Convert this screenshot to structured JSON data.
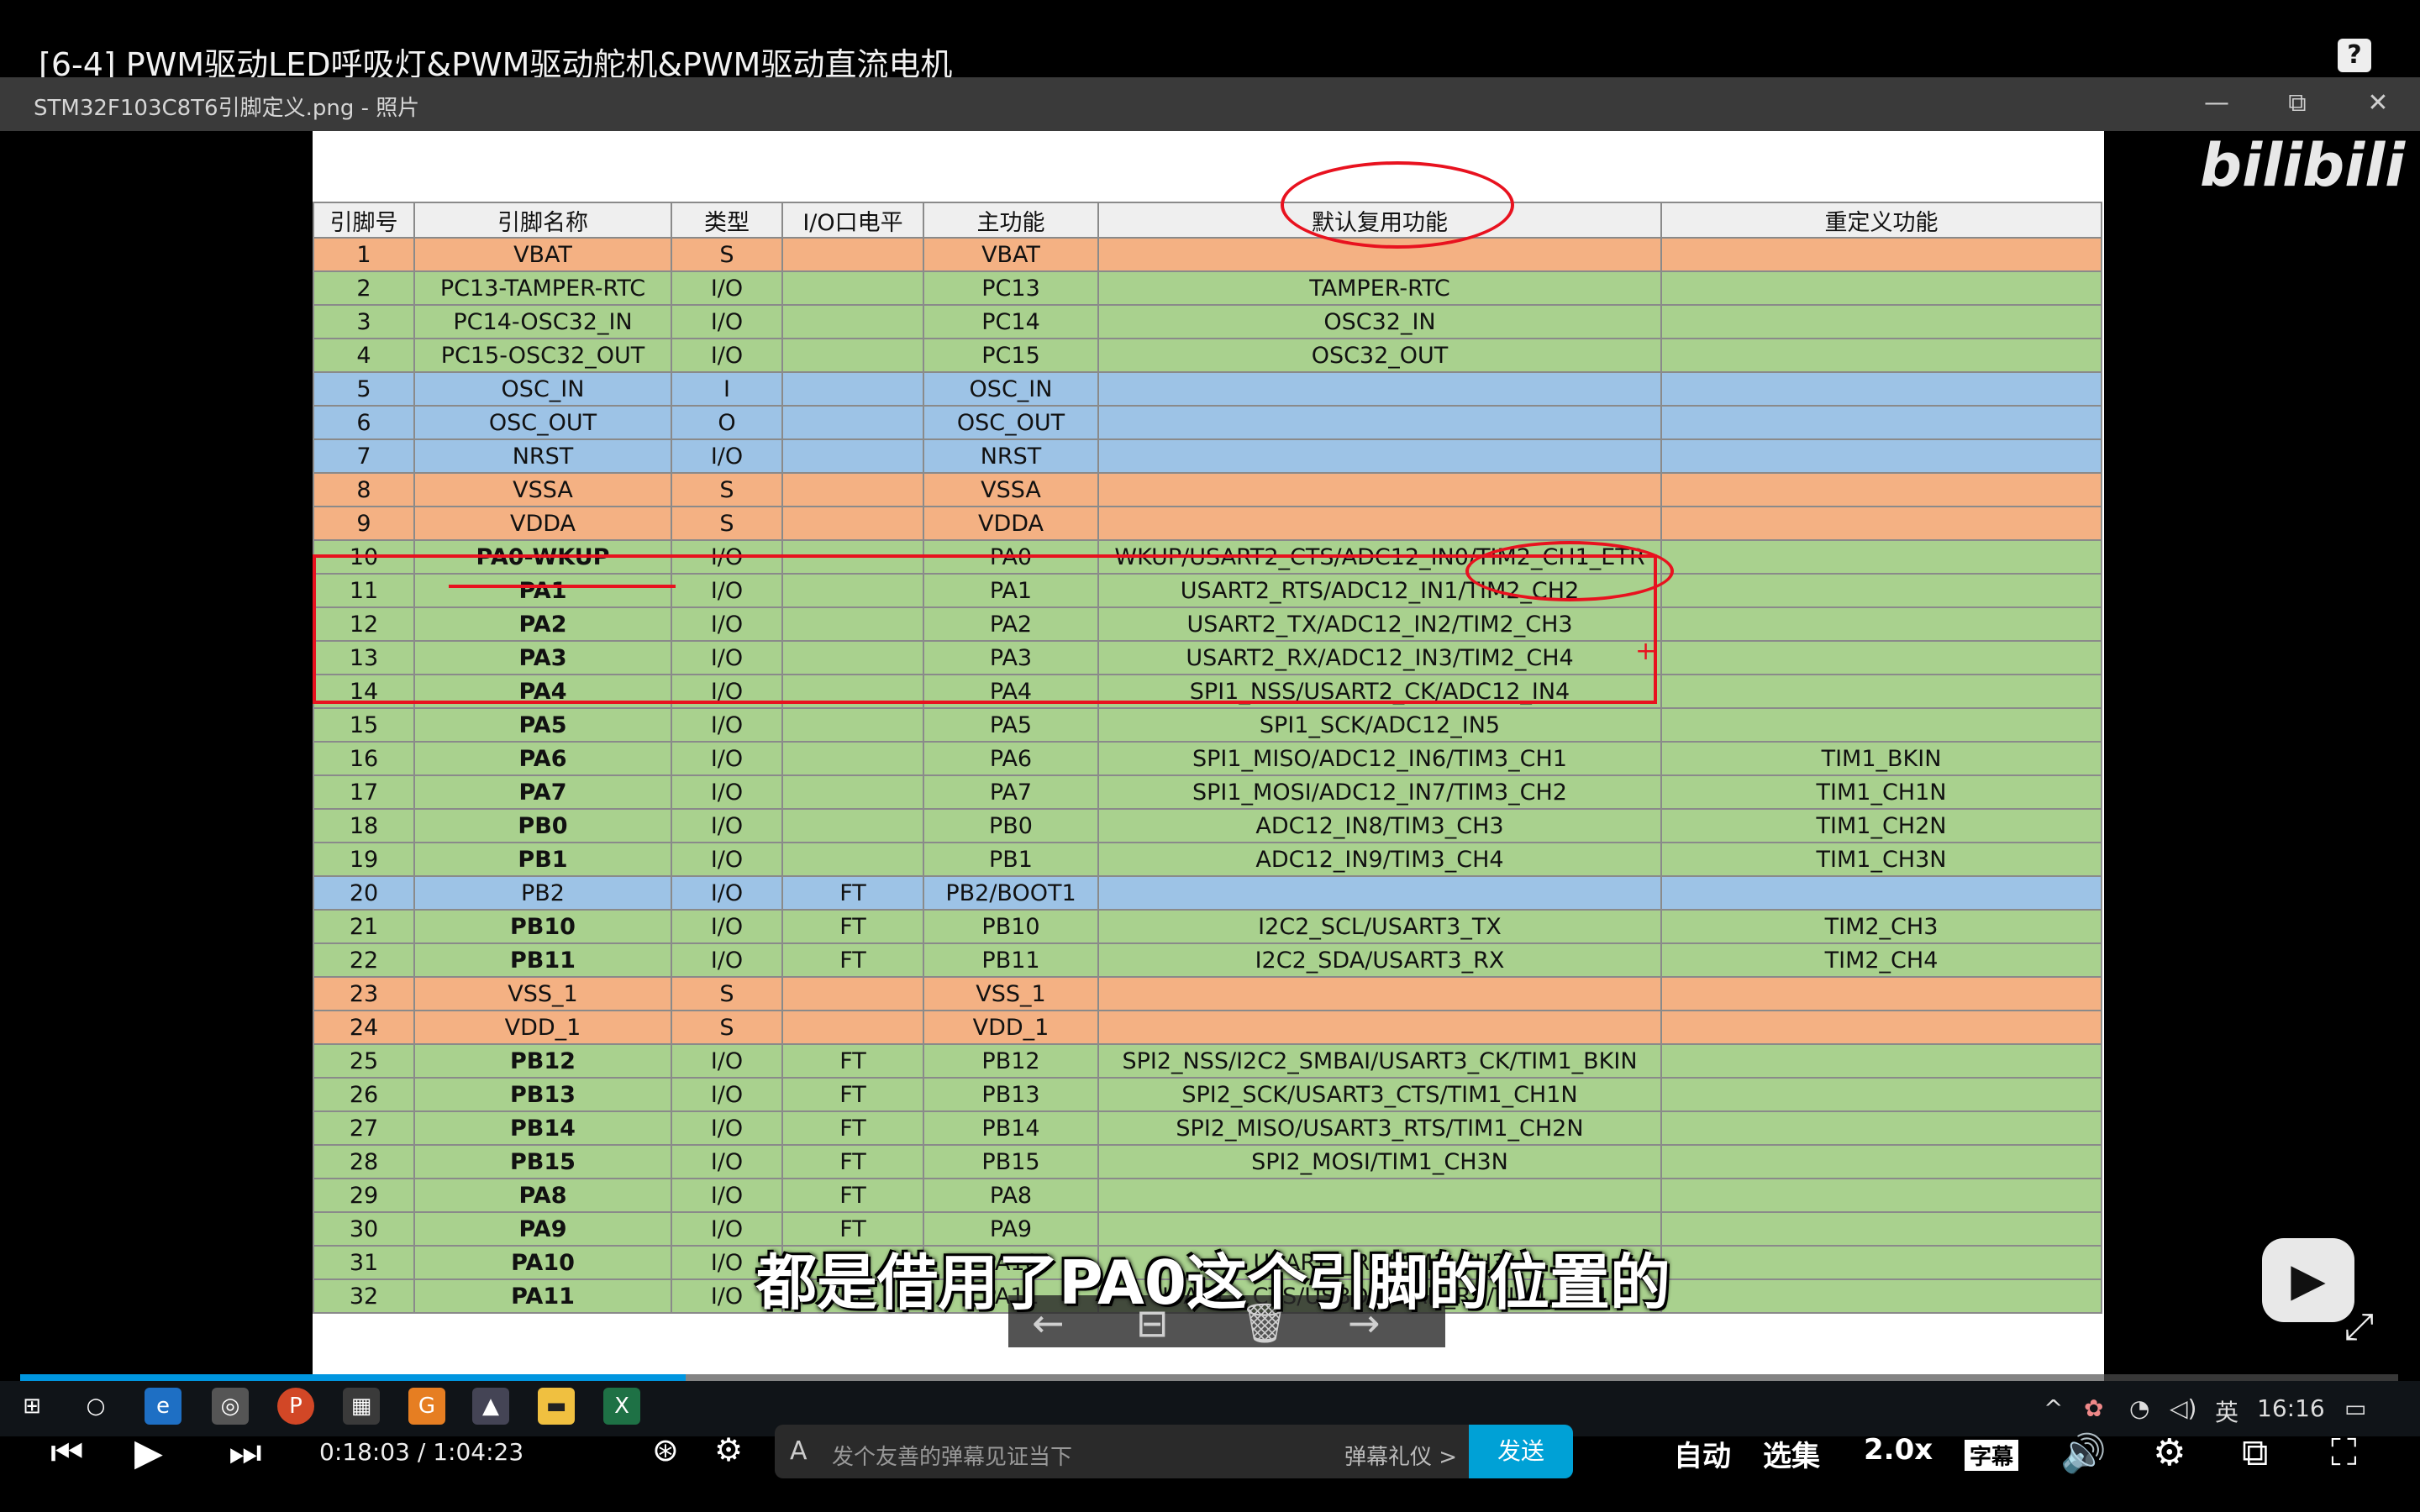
{
  "video": {
    "title": "[6-4] PWM驱动LED呼吸灯&PWM驱动舵机&PWM驱动直流电机",
    "subtitle": "都是借用了PA0这个引脚的位置的"
  },
  "photo_window": {
    "title": "STM32F103C8T6引脚定义.png - 照片",
    "minimize": "—",
    "restore": "⧉",
    "close": "✕"
  },
  "watermark": "bilibili",
  "table": {
    "headers": [
      "引脚号",
      "引脚名称",
      "类型",
      "I/O口电平",
      "主功能",
      "默认复用功能",
      "重定义功能"
    ],
    "rows": [
      {
        "n": "1",
        "name": "VBAT",
        "type": "S",
        "level": "",
        "main": "VBAT",
        "alt": "",
        "remap": "",
        "color": "orange",
        "bold": false
      },
      {
        "n": "2",
        "name": "PC13-TAMPER-RTC",
        "type": "I/O",
        "level": "",
        "main": "PC13",
        "alt": "TAMPER-RTC",
        "remap": "",
        "color": "green",
        "bold": false
      },
      {
        "n": "3",
        "name": "PC14-OSC32_IN",
        "type": "I/O",
        "level": "",
        "main": "PC14",
        "alt": "OSC32_IN",
        "remap": "",
        "color": "green",
        "bold": false
      },
      {
        "n": "4",
        "name": "PC15-OSC32_OUT",
        "type": "I/O",
        "level": "",
        "main": "PC15",
        "alt": "OSC32_OUT",
        "remap": "",
        "color": "green",
        "bold": false
      },
      {
        "n": "5",
        "name": "OSC_IN",
        "type": "I",
        "level": "",
        "main": "OSC_IN",
        "alt": "",
        "remap": "",
        "color": "blue",
        "bold": false
      },
      {
        "n": "6",
        "name": "OSC_OUT",
        "type": "O",
        "level": "",
        "main": "OSC_OUT",
        "alt": "",
        "remap": "",
        "color": "blue",
        "bold": false
      },
      {
        "n": "7",
        "name": "NRST",
        "type": "I/O",
        "level": "",
        "main": "NRST",
        "alt": "",
        "remap": "",
        "color": "blue",
        "bold": false
      },
      {
        "n": "8",
        "name": "VSSA",
        "type": "S",
        "level": "",
        "main": "VSSA",
        "alt": "",
        "remap": "",
        "color": "orange",
        "bold": false
      },
      {
        "n": "9",
        "name": "VDDA",
        "type": "S",
        "level": "",
        "main": "VDDA",
        "alt": "",
        "remap": "",
        "color": "orange",
        "bold": false
      },
      {
        "n": "10",
        "name": "PA0-WKUP",
        "type": "I/O",
        "level": "",
        "main": "PA0",
        "alt": "WKUP/USART2_CTS/ADC12_IN0/TIM2_CH1_ETR",
        "remap": "",
        "color": "green",
        "bold": true
      },
      {
        "n": "11",
        "name": "PA1",
        "type": "I/O",
        "level": "",
        "main": "PA1",
        "alt": "USART2_RTS/ADC12_IN1/TIM2_CH2",
        "remap": "",
        "color": "green",
        "bold": true
      },
      {
        "n": "12",
        "name": "PA2",
        "type": "I/O",
        "level": "",
        "main": "PA2",
        "alt": "USART2_TX/ADC12_IN2/TIM2_CH3",
        "remap": "",
        "color": "green",
        "bold": true
      },
      {
        "n": "13",
        "name": "PA3",
        "type": "I/O",
        "level": "",
        "main": "PA3",
        "alt": "USART2_RX/ADC12_IN3/TIM2_CH4",
        "remap": "",
        "color": "green",
        "bold": true
      },
      {
        "n": "14",
        "name": "PA4",
        "type": "I/O",
        "level": "",
        "main": "PA4",
        "alt": "SPI1_NSS/USART2_CK/ADC12_IN4",
        "remap": "",
        "color": "green",
        "bold": true
      },
      {
        "n": "15",
        "name": "PA5",
        "type": "I/O",
        "level": "",
        "main": "PA5",
        "alt": "SPI1_SCK/ADC12_IN5",
        "remap": "",
        "color": "green",
        "bold": true
      },
      {
        "n": "16",
        "name": "PA6",
        "type": "I/O",
        "level": "",
        "main": "PA6",
        "alt": "SPI1_MISO/ADC12_IN6/TIM3_CH1",
        "remap": "TIM1_BKIN",
        "color": "green",
        "bold": true
      },
      {
        "n": "17",
        "name": "PA7",
        "type": "I/O",
        "level": "",
        "main": "PA7",
        "alt": "SPI1_MOSI/ADC12_IN7/TIM3_CH2",
        "remap": "TIM1_CH1N",
        "color": "green",
        "bold": true
      },
      {
        "n": "18",
        "name": "PB0",
        "type": "I/O",
        "level": "",
        "main": "PB0",
        "alt": "ADC12_IN8/TIM3_CH3",
        "remap": "TIM1_CH2N",
        "color": "green",
        "bold": true
      },
      {
        "n": "19",
        "name": "PB1",
        "type": "I/O",
        "level": "",
        "main": "PB1",
        "alt": "ADC12_IN9/TIM3_CH4",
        "remap": "TIM1_CH3N",
        "color": "green",
        "bold": true
      },
      {
        "n": "20",
        "name": "PB2",
        "type": "I/O",
        "level": "FT",
        "main": "PB2/BOOT1",
        "alt": "",
        "remap": "",
        "color": "blue",
        "bold": false
      },
      {
        "n": "21",
        "name": "PB10",
        "type": "I/O",
        "level": "FT",
        "main": "PB10",
        "alt": "I2C2_SCL/USART3_TX",
        "remap": "TIM2_CH3",
        "color": "green",
        "bold": true
      },
      {
        "n": "22",
        "name": "PB11",
        "type": "I/O",
        "level": "FT",
        "main": "PB11",
        "alt": "I2C2_SDA/USART3_RX",
        "remap": "TIM2_CH4",
        "color": "green",
        "bold": true
      },
      {
        "n": "23",
        "name": "VSS_1",
        "type": "S",
        "level": "",
        "main": "VSS_1",
        "alt": "",
        "remap": "",
        "color": "orange",
        "bold": false
      },
      {
        "n": "24",
        "name": "VDD_1",
        "type": "S",
        "level": "",
        "main": "VDD_1",
        "alt": "",
        "remap": "",
        "color": "orange",
        "bold": false
      },
      {
        "n": "25",
        "name": "PB12",
        "type": "I/O",
        "level": "FT",
        "main": "PB12",
        "alt": "SPI2_NSS/I2C2_SMBAI/USART3_CK/TIM1_BKIN",
        "remap": "",
        "color": "green",
        "bold": true
      },
      {
        "n": "26",
        "name": "PB13",
        "type": "I/O",
        "level": "FT",
        "main": "PB13",
        "alt": "SPI2_SCK/USART3_CTS/TIM1_CH1N",
        "remap": "",
        "color": "green",
        "bold": true
      },
      {
        "n": "27",
        "name": "PB14",
        "type": "I/O",
        "level": "FT",
        "main": "PB14",
        "alt": "SPI2_MISO/USART3_RTS/TIM1_CH2N",
        "remap": "",
        "color": "green",
        "bold": true
      },
      {
        "n": "28",
        "name": "PB15",
        "type": "I/O",
        "level": "FT",
        "main": "PB15",
        "alt": "SPI2_MOSI/TIM1_CH3N",
        "remap": "",
        "color": "green",
        "bold": true
      },
      {
        "n": "29",
        "name": "PA8",
        "type": "I/O",
        "level": "FT",
        "main": "PA8",
        "alt": "",
        "remap": "",
        "color": "green",
        "bold": true
      },
      {
        "n": "30",
        "name": "PA9",
        "type": "I/O",
        "level": "FT",
        "main": "PA9",
        "alt": "",
        "remap": "",
        "color": "green",
        "bold": true
      },
      {
        "n": "31",
        "name": "PA10",
        "type": "I/O",
        "level": "FT",
        "main": "PA10",
        "alt": "USART1_RX/TIM1_CH3",
        "remap": "",
        "color": "green",
        "bold": true
      },
      {
        "n": "32",
        "name": "PA11",
        "type": "I/O",
        "level": "FT",
        "main": "PA11",
        "alt": "USART1_CTS/USBDM/CAN_RX/TIM1_CH4",
        "remap": "",
        "color": "green",
        "bold": true
      }
    ]
  },
  "viewer_controls": {
    "prev": "←",
    "mode": "⊟",
    "delete": "🗑",
    "next": "→"
  },
  "taskbar": {
    "icons": [
      "windows-start-icon",
      "search-circle-icon",
      "edge-icon",
      "settings-app-icon",
      "powerpoint-icon",
      "app-icon",
      "office-icon",
      "photos-icon",
      "explorer-icon",
      "excel-icon"
    ],
    "ime": "英",
    "clock": "16:16"
  },
  "player": {
    "current_time": "0:18:03",
    "separator": "/",
    "duration": "1:04:23",
    "progress_percent": 28.0,
    "danmaku_placeholder": "发个友善的弹幕见证当下",
    "danmaku_etiquette": "弹幕礼仪 >",
    "send_label": "发送",
    "auto_label": "自动",
    "episodes_label": "选集",
    "speed_label": "2.0x",
    "subtitle_toggle": "字幕"
  },
  "colors": {
    "accent": "#00a1d6",
    "annotation": "#e8121f",
    "orange_row": "#f4b183",
    "green_row": "#a9d18e",
    "blue_row": "#9dc3e6"
  }
}
